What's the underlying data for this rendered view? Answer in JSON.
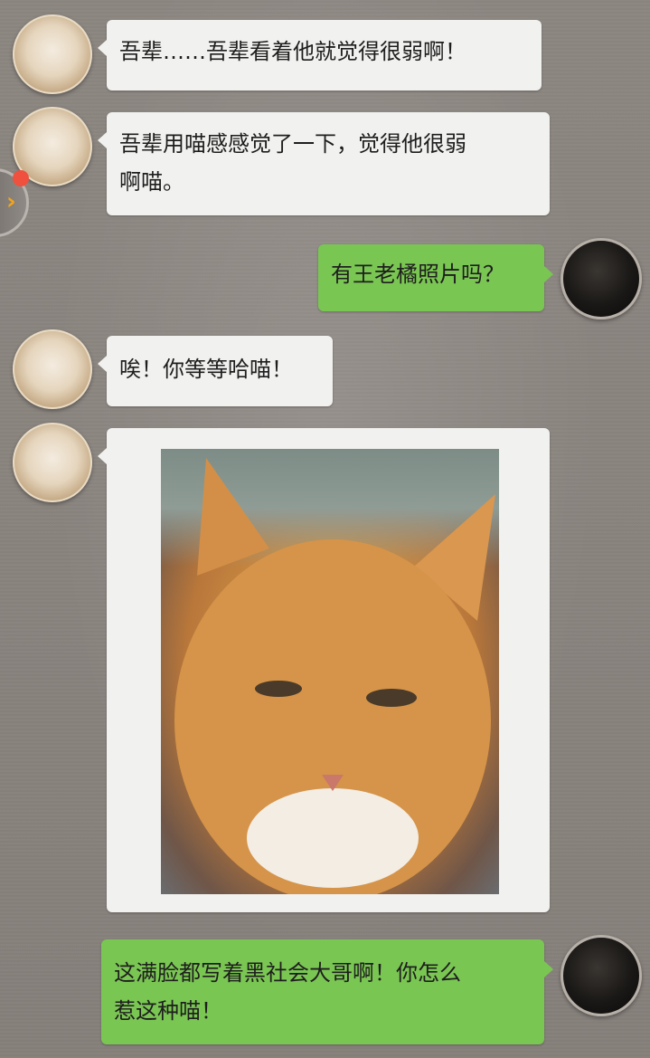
{
  "chat": {
    "messages": [
      {
        "sender": "cat",
        "text": "吾辈……吾辈看着他就觉得很弱啊！"
      },
      {
        "sender": "cat",
        "text": "吾辈用喵感感觉了一下，觉得他很弱\n啊喵。"
      },
      {
        "sender": "me",
        "text": "有王老橘照片吗？"
      },
      {
        "sender": "cat",
        "text": "唉！你等等哈喵！"
      },
      {
        "sender": "cat",
        "image": "orange-cat-photo"
      },
      {
        "sender": "me",
        "text": "这满脸都写着黑社会大哥啊！你怎么\n惹这种喵！"
      }
    ]
  },
  "floating_button": {
    "icon": "chevron-right-icon",
    "badge_color": "#f0503e"
  },
  "colors": {
    "left_bubble": "#f1f1ef",
    "right_bubble": "#7ac653",
    "accent": "#f2a41c"
  }
}
